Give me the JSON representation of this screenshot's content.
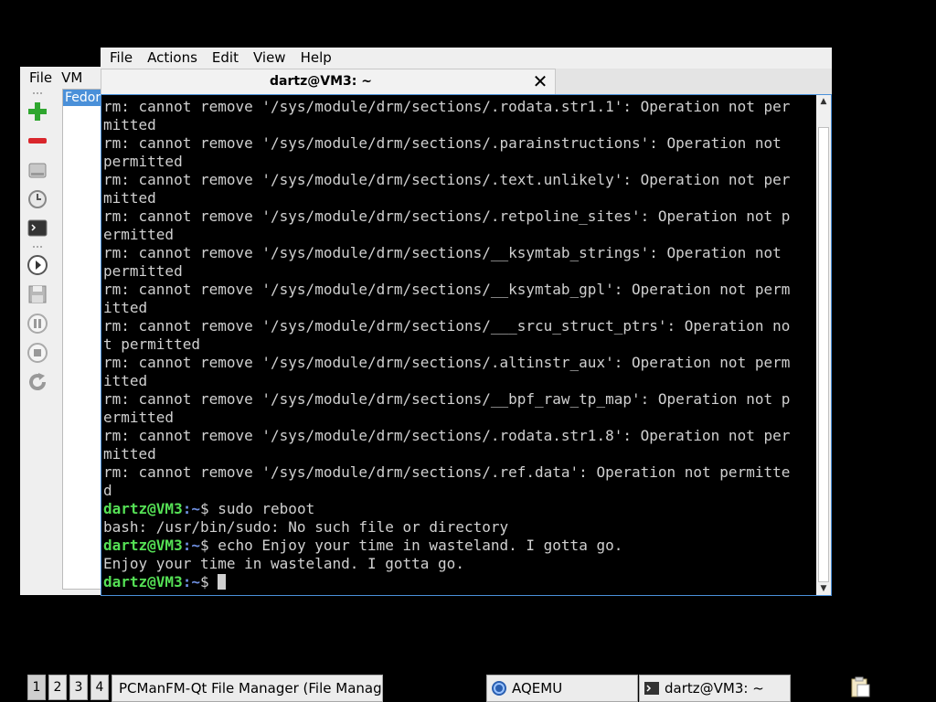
{
  "aqemu": {
    "menu": [
      {
        "label": "File"
      },
      {
        "label": "VM"
      }
    ],
    "vm_list": [
      {
        "label": "Fedora"
      }
    ],
    "toolbar": [
      "add-vm-icon",
      "remove-vm-icon",
      "hard-disk-icon",
      "clock-icon",
      "terminal-icon",
      "play-icon",
      "save-icon",
      "pause-icon",
      "stop-icon",
      "reset-icon"
    ]
  },
  "terminal": {
    "menu": [
      {
        "label": "File"
      },
      {
        "label": "Actions"
      },
      {
        "label": "Edit"
      },
      {
        "label": "View"
      },
      {
        "label": "Help"
      }
    ],
    "tab_title": "dartz@VM3: ~",
    "tab_close": "✕",
    "output_lines": [
      "rm: cannot remove '/sys/module/drm/sections/.rodata.str1.1': Operation not per",
      "mitted",
      "rm: cannot remove '/sys/module/drm/sections/.parainstructions': Operation not",
      "permitted",
      "rm: cannot remove '/sys/module/drm/sections/.text.unlikely': Operation not per",
      "mitted",
      "rm: cannot remove '/sys/module/drm/sections/.retpoline_sites': Operation not p",
      "ermitted",
      "rm: cannot remove '/sys/module/drm/sections/__ksymtab_strings': Operation not",
      "permitted",
      "rm: cannot remove '/sys/module/drm/sections/__ksymtab_gpl': Operation not perm",
      "itted",
      "rm: cannot remove '/sys/module/drm/sections/___srcu_struct_ptrs': Operation no",
      "t permitted",
      "rm: cannot remove '/sys/module/drm/sections/.altinstr_aux': Operation not perm",
      "itted",
      "rm: cannot remove '/sys/module/drm/sections/__bpf_raw_tp_map': Operation not p",
      "ermitted",
      "rm: cannot remove '/sys/module/drm/sections/.rodata.str1.8': Operation not per",
      "mitted",
      "rm: cannot remove '/sys/module/drm/sections/.ref.data': Operation not permitte",
      "d"
    ],
    "prompt_user": "dartz@VM3",
    "prompt_path": ":~",
    "prompt_symbol": "$",
    "command_1": " sudo reboot",
    "output_1": "bash: /usr/bin/sudo: No such file or directory",
    "command_2": " echo Enjoy your time in wasteland. I gotta go.",
    "output_2": "Enjoy your time in wasteland. I gotta go.",
    "scroll": {
      "up": "▲",
      "down": "▼",
      "thumb_fraction": 0.96,
      "position": 1.0
    }
  },
  "taskbar": {
    "desktops": [
      "1",
      "2",
      "3",
      "4"
    ],
    "active_desktop": 0,
    "tasks": [
      {
        "label": "PCManFM-Qt File Manager (File Manager)"
      },
      {
        "label": "AQEMU",
        "icon": "aqemu-icon"
      },
      {
        "label": "dartz@VM3: ~",
        "icon": "terminal-icon"
      }
    ],
    "tray_icon": "clipboard-icon"
  },
  "colors": {
    "prompt_user": "#55e055",
    "prompt_path": "#6e8fe0",
    "terminal_text": "#d0d0d0",
    "selection": "#4a90d9"
  }
}
